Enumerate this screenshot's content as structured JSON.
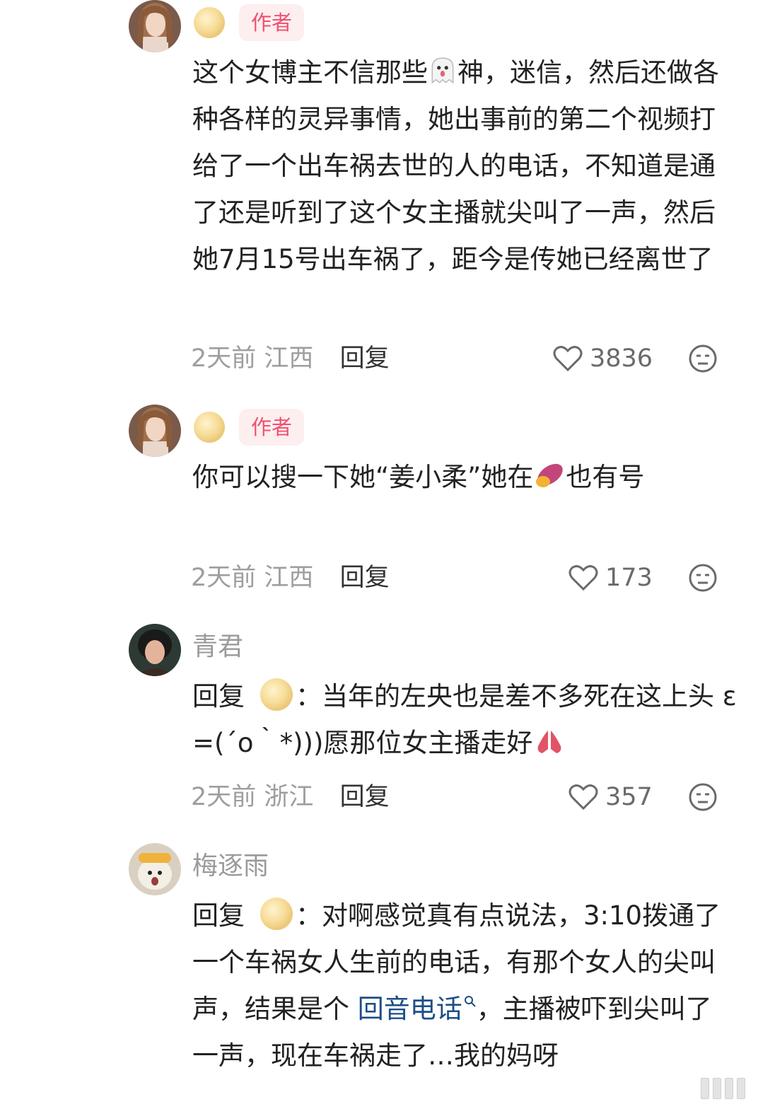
{
  "comments": [
    {
      "author_tag": "作者",
      "text_a": "这个女博主不信那些",
      "text_b": "神，迷信，然后还做各种各样的灵异事情，她出事前的第二个视频打给了一个出车祸去世的人的电话，不知道是通了还是听到了这个女主播就尖叫了一声，然后她7月15号出车祸了，距今是传她已经离世了",
      "emoji": "ghost",
      "time": "2天前",
      "location": "江西",
      "reply": "回复",
      "likes": "3836"
    },
    {
      "author_tag": "作者",
      "text_a": "你可以搜一下她“姜小柔”她在",
      "text_b": "也有号",
      "emoji": "sweet-potato",
      "time": "2天前",
      "location": "江西",
      "reply": "回复",
      "likes": "173"
    },
    {
      "username": "青君",
      "reply_prefix": "回复",
      "text_a": "：当年的左央也是差不多死在这上头 ε =(´ο｀*)))愿那位女主播走好",
      "emoji": "praying-hands",
      "time": "2天前",
      "location": "浙江",
      "reply": "回复",
      "likes": "357"
    },
    {
      "username": "梅逐雨",
      "reply_prefix": "回复",
      "text_a": "：对啊感觉真有点说法，3:10拨通了一个车祸女人生前的电话，有那个女人的尖叫声，结果是个",
      "link_text": "回音电话",
      "text_b": "，主播被吓到尖叫了一声，现在车祸走了…我的妈呀"
    }
  ],
  "colors": {
    "author_tag_bg": "#fdeef0",
    "author_tag_text": "#f0506e",
    "link": "#1d4e87",
    "meta": "#9e9e9e"
  }
}
